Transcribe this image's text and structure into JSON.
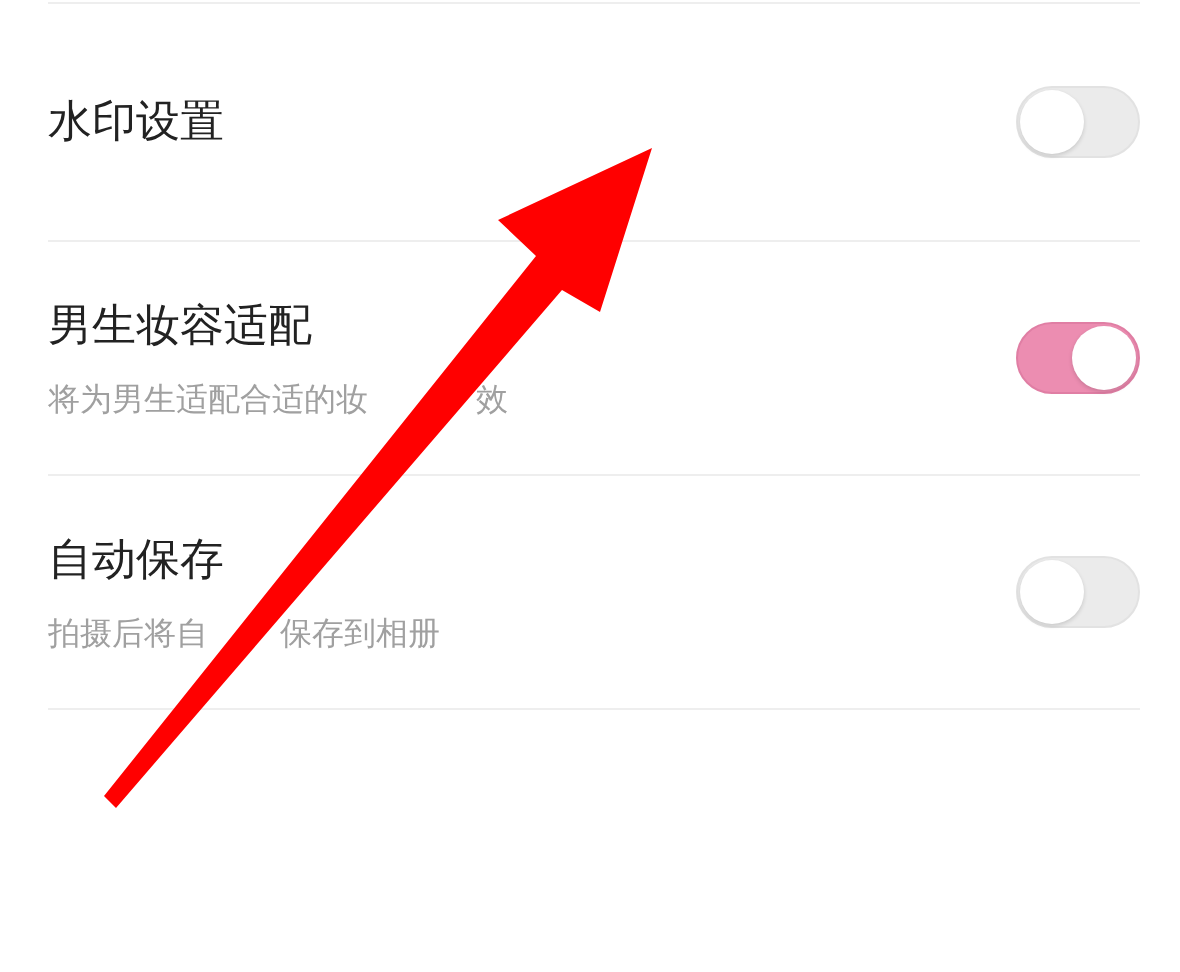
{
  "settings": [
    {
      "kind": "plain",
      "title": "水印设置",
      "on": false
    },
    {
      "kind": "described",
      "title": "男生妆容适配",
      "description_parts": [
        "将为男生适配合适的妆",
        "效"
      ],
      "on": true
    },
    {
      "kind": "described",
      "title": "自动保存",
      "description_parts": [
        "拍摄后将自",
        "保存到相册"
      ],
      "on": false
    }
  ]
}
